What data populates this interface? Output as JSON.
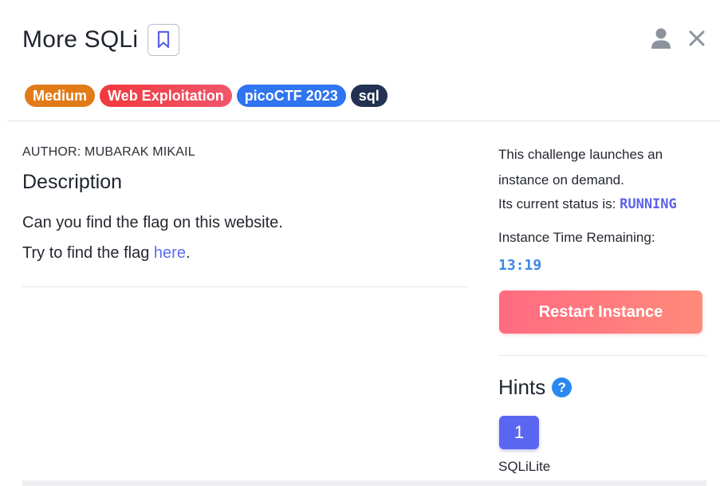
{
  "challenge": {
    "title": "More SQLi",
    "tags": [
      "Medium",
      "Web Exploitation",
      "picoCTF 2023",
      "sql"
    ],
    "author": "AUTHOR: MUBARAK MIKAIL",
    "description_heading": "Description",
    "description_line1": "Can you find the flag on this website.",
    "description_line2_prefix": "Try to find the flag ",
    "description_link": "here",
    "description_line2_suffix": "."
  },
  "instance": {
    "launch_text": "This challenge launches an instance on demand.",
    "status_label": "Its current status is: ",
    "status_value": "RUNNING",
    "time_label": "Instance Time Remaining:",
    "time_value": "13:19",
    "restart_label": "Restart Instance"
  },
  "hints": {
    "heading": "Hints",
    "help_symbol": "?",
    "items": [
      {
        "number": "1",
        "text": "SQLiLite"
      }
    ]
  },
  "icons": {
    "bookmark": "bookmark-icon",
    "user": "user-icon",
    "close": "close-icon",
    "help": "help-icon"
  },
  "colors": {
    "medium": "#e07b18",
    "web_exploitation": "#f2383e",
    "picoctf": "#2f74f0",
    "sql": "#233252",
    "restart": "#ff6b82",
    "hint_button": "#5b66f0",
    "status": "#5a63e6",
    "link": "#5b6ef0"
  }
}
